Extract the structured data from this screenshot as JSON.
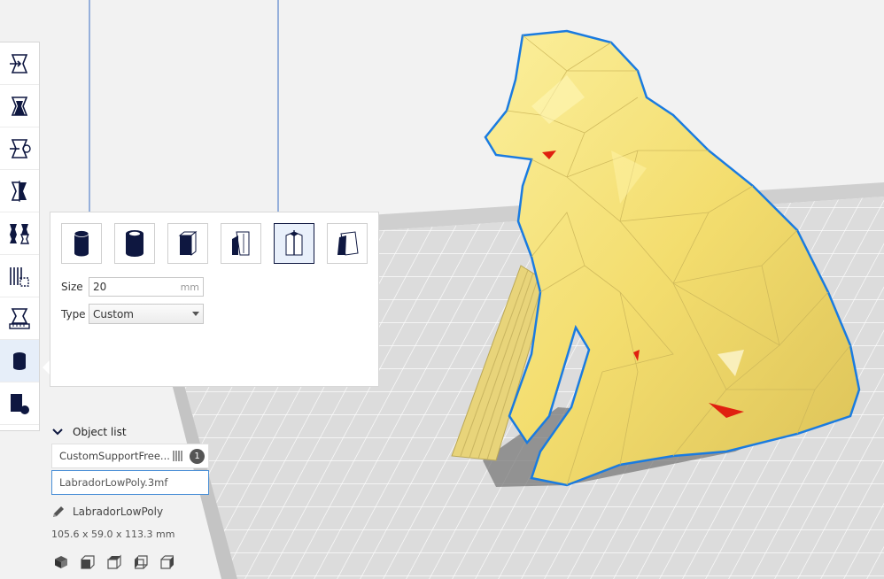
{
  "toolbar": {
    "tools": [
      {
        "icon": "move-icon"
      },
      {
        "icon": "scale-icon"
      },
      {
        "icon": "rotate-icon"
      },
      {
        "icon": "mirror-icon"
      },
      {
        "icon": "per-model-settings-icon"
      },
      {
        "icon": "support-blocker-icon"
      },
      {
        "icon": "measure-icon"
      },
      {
        "icon": "custom-supports-icon",
        "active": true
      },
      {
        "icon": "shape-icon"
      }
    ]
  },
  "support_panel": {
    "shapes": [
      {
        "icon": "cylinder-support-icon"
      },
      {
        "icon": "tube-support-icon"
      },
      {
        "icon": "cube-support-icon"
      },
      {
        "icon": "abutment-support-icon"
      },
      {
        "icon": "freeform-support-icon",
        "selected": true
      },
      {
        "icon": "custom-support-icon"
      }
    ],
    "size_label": "Size",
    "size_value": "20",
    "size_unit": "mm",
    "type_label": "Type",
    "type_value": "Custom"
  },
  "object_list": {
    "header": "Object list",
    "items": [
      {
        "name": "CustomSupportFree...",
        "count": "1"
      },
      {
        "name": "LabradorLowPoly.3mf"
      }
    ]
  },
  "model": {
    "name": "LabradorLowPoly",
    "dimensions": "105.6 x 59.0 x 113.3 mm"
  },
  "view_buttons": [
    "3d-view-icon",
    "front-view-icon",
    "top-view-icon",
    "left-view-icon",
    "right-view-icon"
  ],
  "colors": {
    "accent": "#0e1740",
    "selection": "#4a8fd6",
    "model_yellow": "#f6e27a",
    "build_plate": "#d6d6d6"
  }
}
